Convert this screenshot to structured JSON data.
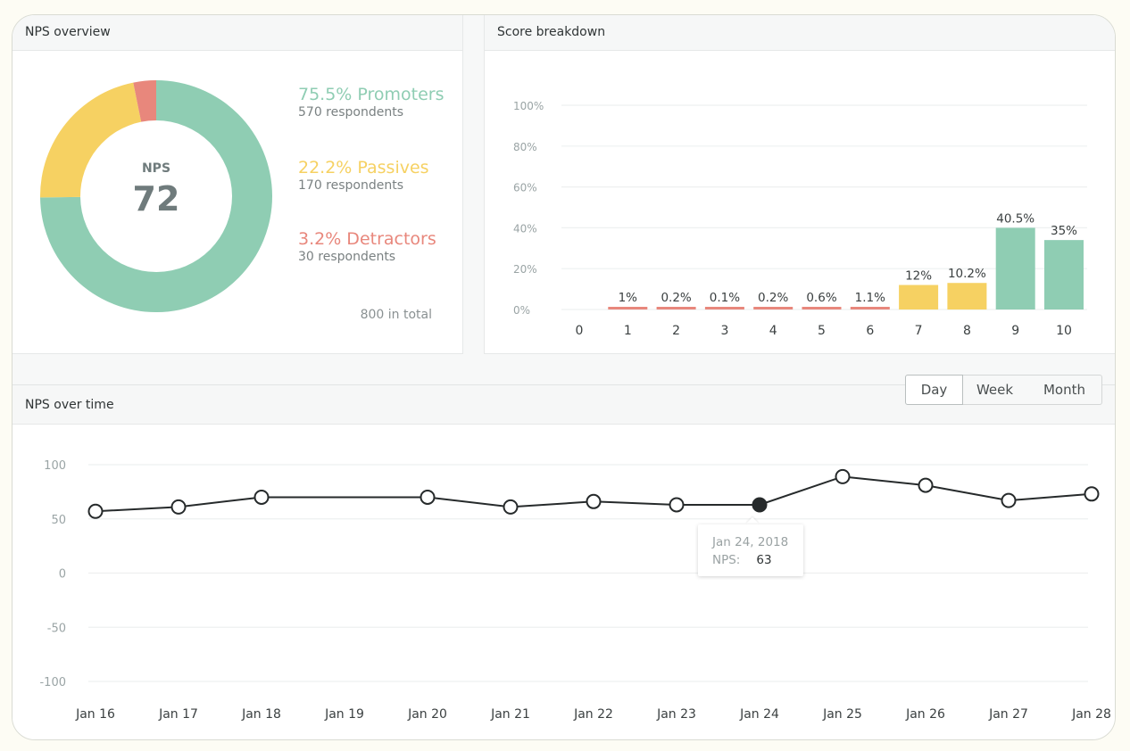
{
  "colors": {
    "promoters": "#8fcdb3",
    "passives": "#f6d162",
    "detractors": "#e8877c",
    "line": "#262a2b",
    "grid": "#eef0f0",
    "axis_text": "#9aa4a5",
    "label_text": "#3b4041"
  },
  "overview": {
    "title": "NPS overview",
    "center_label": "NPS",
    "center_value": "72",
    "segments": [
      {
        "key": "promoters",
        "title": "75.5% Promoters",
        "sub": "570 respondents",
        "percent": 75.5,
        "color": "#8fcdb3"
      },
      {
        "key": "passives",
        "title": "22.2% Passives",
        "sub": "170 respondents",
        "percent": 22.2,
        "color": "#f6d162"
      },
      {
        "key": "detractors",
        "title": "3.2% Detractors",
        "sub": "30 respondents",
        "percent": 3.2,
        "color": "#e8877c"
      }
    ],
    "total": "800 in total"
  },
  "breakdown": {
    "title": "Score breakdown"
  },
  "over_time": {
    "title": "NPS over time",
    "periods": [
      "Day",
      "Week",
      "Month"
    ],
    "active_period": "Day",
    "tooltip": {
      "date": "Jan 24, 2018",
      "label": "NPS:",
      "value": "63"
    }
  },
  "chart_data": [
    {
      "type": "pie",
      "title": "NPS overview",
      "labels": [
        "Promoters",
        "Passives",
        "Detractors"
      ],
      "values": [
        75.5,
        22.2,
        3.2
      ],
      "counts": [
        570,
        170,
        30
      ],
      "center_text": "NPS 72",
      "donut": true
    },
    {
      "type": "bar",
      "title": "Score breakdown",
      "categories": [
        "0",
        "1",
        "2",
        "3",
        "4",
        "5",
        "6",
        "7",
        "8",
        "9",
        "10"
      ],
      "values": [
        0,
        1,
        0.2,
        0.1,
        0.2,
        0.6,
        1.1,
        12,
        10.2,
        40.5,
        35
      ],
      "display_values": [
        0,
        1,
        1,
        1,
        1,
        1.1,
        1.2,
        12,
        13,
        40,
        34
      ],
      "data_labels": [
        "",
        "1%",
        "0.2%",
        "0.1%",
        "0.2%",
        "0.6%",
        "1.1%",
        "12%",
        "10.2%",
        "40.5%",
        "35%"
      ],
      "bar_groups": [
        "none",
        "detractors",
        "detractors",
        "detractors",
        "detractors",
        "detractors",
        "detractors",
        "passives",
        "passives",
        "promoters",
        "promoters"
      ],
      "yticks": [
        "0%",
        "20%",
        "40%",
        "60%",
        "80%",
        "100%"
      ],
      "ylim": [
        0,
        100
      ],
      "grid": true
    },
    {
      "type": "line",
      "title": "NPS over time",
      "x": [
        "Jan 16",
        "Jan 17",
        "Jan 18",
        "Jan 19",
        "Jan 20",
        "Jan 21",
        "Jan 22",
        "Jan 23",
        "Jan 24",
        "Jan 25",
        "Jan 26",
        "Jan 27",
        "Jan 28"
      ],
      "values": [
        57,
        61,
        70,
        null,
        70,
        61,
        66,
        63,
        63,
        89,
        81,
        67,
        73
      ],
      "highlighted_index": 8,
      "yticks": [
        "100",
        "50",
        "0",
        "-50",
        "-100"
      ],
      "ylim": [
        -100,
        100
      ],
      "grid": true
    }
  ]
}
